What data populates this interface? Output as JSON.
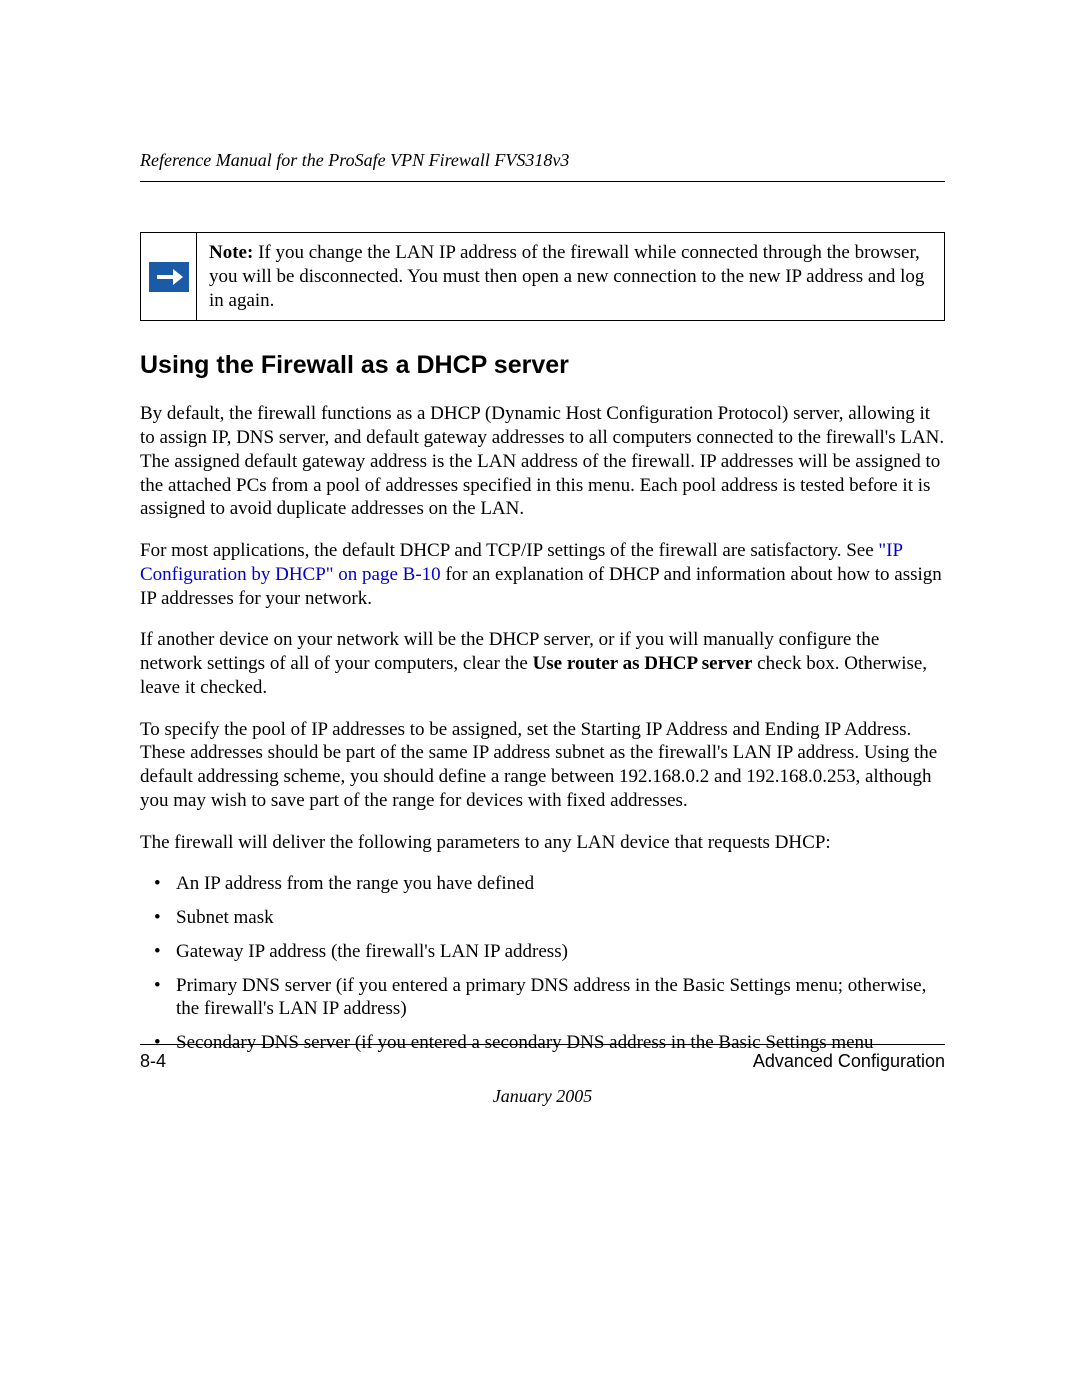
{
  "header": {
    "running_title": "Reference Manual for the ProSafe VPN Firewall FVS318v3"
  },
  "note": {
    "label": "Note:",
    "text": " If you change the LAN IP address of the firewall while connected through the browser, you will be disconnected. You must then open a new connection to the new IP address and log in again."
  },
  "section": {
    "heading": "Using the Firewall as a DHCP server",
    "p1": "By default, the firewall functions as a DHCP (Dynamic Host Configuration Protocol) server, allowing it to assign IP, DNS server, and default gateway addresses to all computers connected to the firewall's LAN. The assigned default gateway address is the LAN address of the firewall. IP addresses will be assigned to the attached PCs from a pool of addresses specified in this menu. Each pool address is tested before it is assigned to avoid duplicate addresses on the LAN.",
    "p2_pre": "For most applications, the default DHCP and TCP/IP settings of the firewall are satisfactory. See ",
    "p2_link": "\"IP Configuration by DHCP\" on page B-10",
    "p2_post": " for an explanation of DHCP and information about how to assign IP addresses for your network.",
    "p3_pre": "If another device on your network will be the DHCP server, or if you will manually configure the network settings of all of your computers, clear the ",
    "p3_bold": "Use router as DHCP server",
    "p3_post": " check box. Otherwise, leave it checked.",
    "p4": "To specify the pool of IP addresses to be assigned, set the Starting IP Address and Ending IP Address. These addresses should be part of the same IP address subnet as the firewall's LAN IP address. Using the default addressing scheme, you should define a range between 192.168.0.2 and 192.168.0.253, although you may wish to save part of the range for devices with fixed addresses.",
    "p5": "The firewall will deliver the following parameters to any LAN device that requests DHCP:",
    "bullets": [
      "An IP address from the range you have defined",
      "Subnet mask",
      "Gateway IP address (the firewall's LAN IP address)",
      "Primary DNS server (if you entered a primary DNS address in the Basic Settings menu; otherwise, the firewall's LAN IP address)",
      "Secondary DNS server (if you entered a secondary DNS address in the Basic Settings menu"
    ]
  },
  "footer": {
    "page_number": "8-4",
    "section_name": "Advanced Configuration",
    "date": "January 2005"
  }
}
